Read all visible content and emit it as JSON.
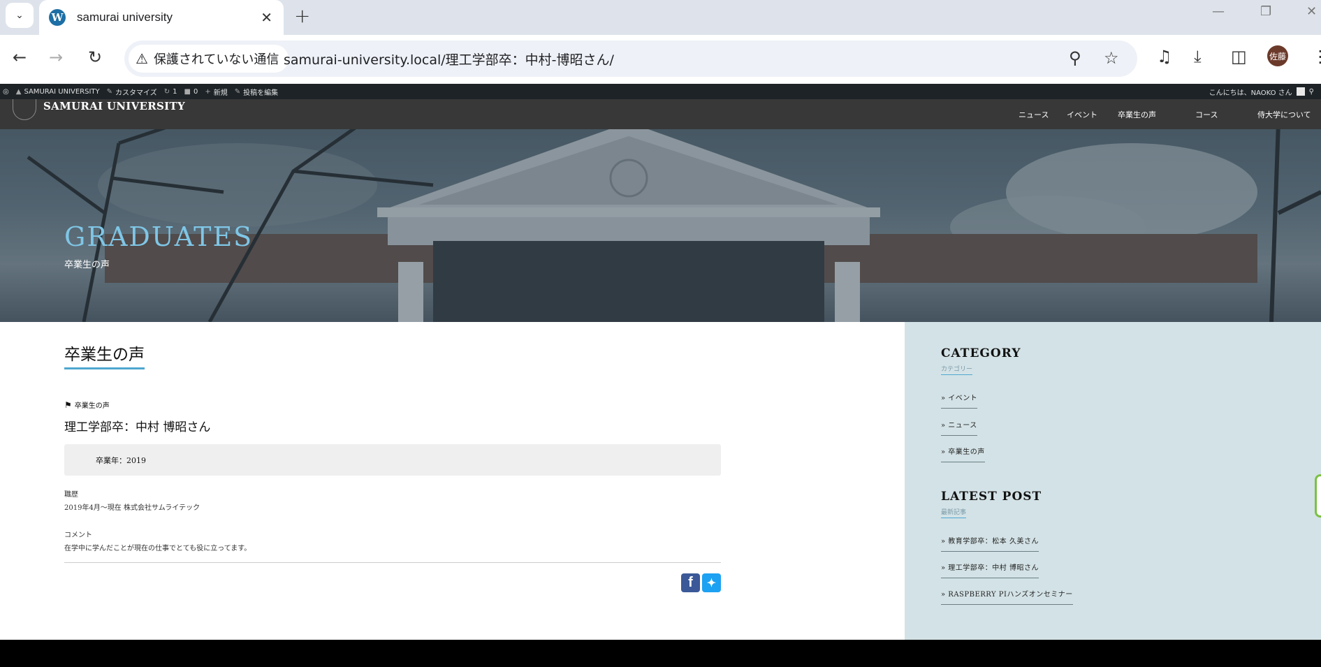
{
  "browser": {
    "tab_title": "samurai university",
    "security_label": "保護されていない通信",
    "url": "samurai-university.local/理工学部卒：中村-博昭さん/",
    "profile_initials": "佐藤"
  },
  "adminbar": {
    "site_name": "SAMURAI UNIVERSITY",
    "customize": "カスタマイズ",
    "updates_count": "1",
    "comments_count": "0",
    "new_label": "新規",
    "edit_label": "投稿を編集",
    "greeting": "こんにちは、NAOKO さん"
  },
  "site": {
    "logo_text": "SAMURAI UNIVERSITY",
    "menu": [
      "ニュース",
      "イベント",
      "卒業生の声",
      "コース",
      "侍大学について"
    ]
  },
  "hero": {
    "title": "GRADUATES",
    "subtitle": "卒業生の声"
  },
  "main": {
    "page_heading": "卒業生の声",
    "category_tag": "卒業生の声",
    "post_title": "理工学部卒：中村 博昭さん",
    "graduation_year": "卒業年：2019",
    "career_label": "職歴",
    "career_value": "2019年4月〜現在 株式会社サムライテック",
    "comment_label": "コメント",
    "comment_value": "在学中に学んだことが現在の仕事でとても役に立ってます。"
  },
  "sidebar": {
    "category_heading": "CATEGORY",
    "category_sub": "カテゴリー",
    "categories": [
      "» イベント",
      "» ニュース",
      "» 卒業生の声"
    ],
    "latest_heading": "LATEST POST",
    "latest_sub": "最新記事",
    "latest_posts": [
      "» 教育学部卒：松本 久美さん",
      "» 理工学部卒：中村 博昭さん",
      "» RASPBERRY PIハンズオンセミナー"
    ]
  },
  "colors": {
    "accent": "#4ea7d0",
    "hero_title": "#7fc6e6",
    "sidebar_bg": "#d3e2e6",
    "facebook": "#3b5998",
    "twitter": "#1da1f2"
  },
  "icons": [
    "tab-search-chevron-icon",
    "wordpress-icon",
    "close-icon",
    "plus-icon",
    "back-icon",
    "forward-icon",
    "reload-icon",
    "warning-icon",
    "zoom-icon",
    "star-icon",
    "media-icon",
    "download-icon",
    "sidepanel-icon",
    "menu-icon",
    "tag-icon",
    "facebook-icon",
    "twitter-icon"
  ]
}
